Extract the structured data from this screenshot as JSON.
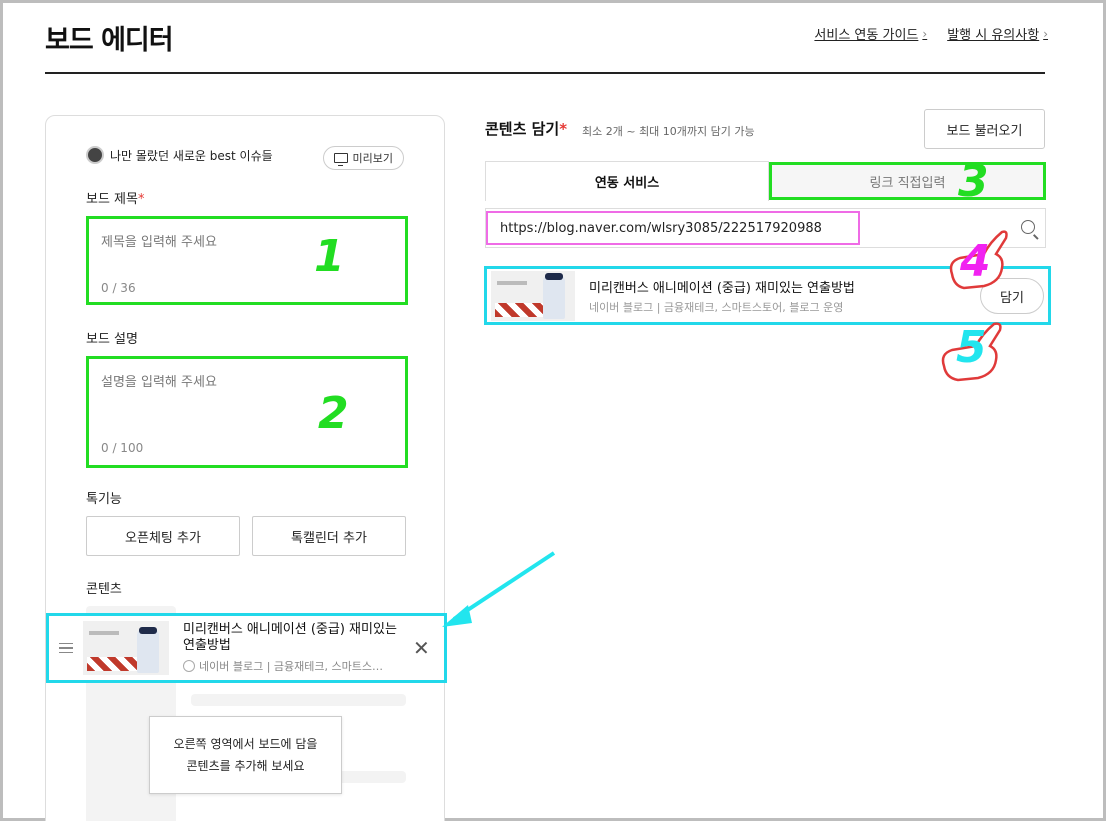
{
  "header": {
    "title": "보드 에디터",
    "links": [
      {
        "label": "서비스 연동 가이드"
      },
      {
        "label": "발행 시 유의사항"
      }
    ]
  },
  "left": {
    "profile_name": "나만 몰랐던 새로운 best 이슈들",
    "preview_label": "미리보기",
    "board_title_label": "보드 제목",
    "board_title_required": "*",
    "board_title_placeholder": "제목을 입력해 주세요",
    "board_title_count": "0 / 36",
    "board_desc_label": "보드 설명",
    "board_desc_placeholder": "설명을 입력해 주세요",
    "board_desc_count": "0 / 100",
    "special_label": "톡기능",
    "open_chat_button": "오픈체팅 추가",
    "talk_calendar_button": "톡캘린더 추가",
    "contents_label": "콘텐츠",
    "content_item": {
      "title": "미리캔버스 애니메이션 (중급) 재미있는 연출방법",
      "source": "네이버 블로그 | 금융재테크, 스마트스…"
    },
    "tooltip_line1": "오른쪽 영역에서 보드에 담을",
    "tooltip_line2": "콘텐츠를 추가해 보세요"
  },
  "right": {
    "title": "콘텐츠 담기",
    "required": "*",
    "hint": "최소 2개 ~ 최대 10개까지 담기 가능",
    "load_button": "보드 불러오기",
    "tabs": [
      {
        "label": "연동 서비스"
      },
      {
        "label": "링크 직접입력"
      }
    ],
    "url_value": "https://blog.naver.com/wlsry3085/222517920988",
    "result": {
      "title": "미리캔버스 애니메이션 (중급) 재미있는 연출방법",
      "source": "네이버 블로그 | 금융재테크, 스마트스토어, 블로그 운영",
      "add_button": "담기"
    }
  },
  "annotations": {
    "n1": "1",
    "n2": "2",
    "n3": "3",
    "n4": "4",
    "n5": "5"
  },
  "colors": {
    "annot_green": "#22dd22",
    "annot_magenta": "#f122f1",
    "annot_cyan": "#22e5ee",
    "required_red": "#e53935"
  }
}
